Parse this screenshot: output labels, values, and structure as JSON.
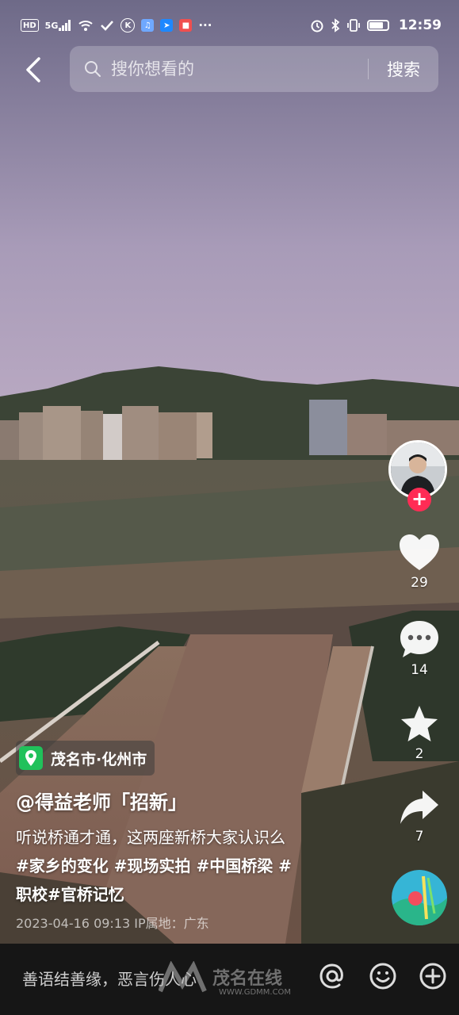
{
  "status_bar": {
    "network_label": "HD",
    "signal_label": "5G",
    "time": "12:59",
    "battery_percent": 80
  },
  "header": {
    "back_icon": "chevron-left-icon",
    "search_placeholder": "搜你想看的",
    "search_button": "搜索"
  },
  "actions": {
    "likes": "29",
    "comments": "14",
    "favorites": "2",
    "shares": "7"
  },
  "video": {
    "location": "茂名市·化州市",
    "author": "@得益老师「招新」",
    "caption_text": "听说桥通才通，这两座新桥大家认识么",
    "hashtags_line1": "#家乡的变化 #现场实拍 #中国桥梁 #",
    "hashtags_line2": "职校#官桥记忆",
    "meta": "2023-04-16 09:13  IP属地：广东"
  },
  "comment_bar": {
    "placeholder": "善语结善缘，恶言伤人心"
  },
  "watermark": {
    "brand": "茂名在线",
    "url": "WWW.GDMM.COM"
  },
  "colors": {
    "accent": "#ff2c55",
    "location_green": "#20c15b"
  }
}
